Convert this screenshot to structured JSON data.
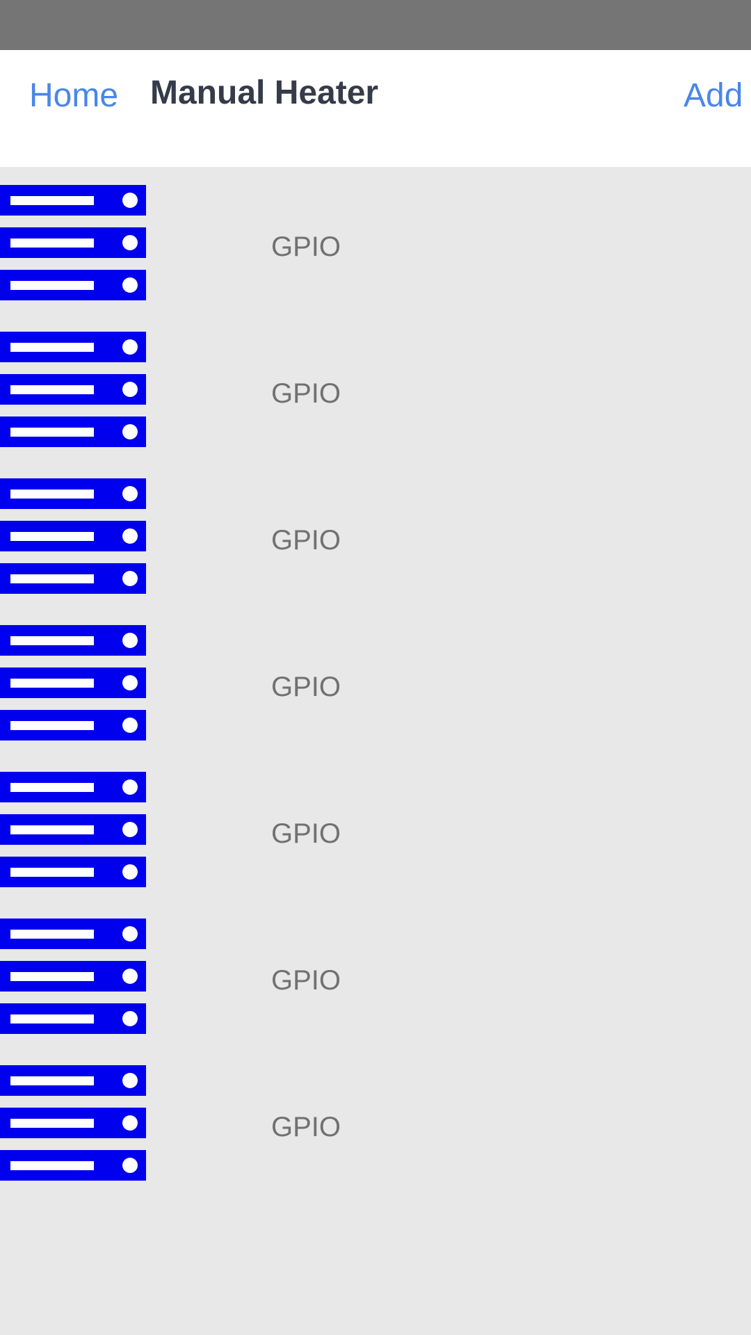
{
  "nav": {
    "back_label": "Home",
    "title": "Manual Heater",
    "add_label": "Add"
  },
  "items": [
    {
      "label": "GPIO",
      "icon": "server-icon"
    },
    {
      "label": "GPIO",
      "icon": "server-icon"
    },
    {
      "label": "GPIO",
      "icon": "server-icon"
    },
    {
      "label": "GPIO",
      "icon": "server-icon"
    },
    {
      "label": "GPIO",
      "icon": "server-icon"
    },
    {
      "label": "GPIO",
      "icon": "server-icon"
    },
    {
      "label": "GPIO",
      "icon": "server-icon"
    }
  ],
  "colors": {
    "status_bar": "#757575",
    "nav_background": "#ffffff",
    "link": "#4a86e8",
    "title": "#353b4a",
    "list_background": "#e8e8e9",
    "icon": "#0000ee",
    "label": "#717171"
  }
}
